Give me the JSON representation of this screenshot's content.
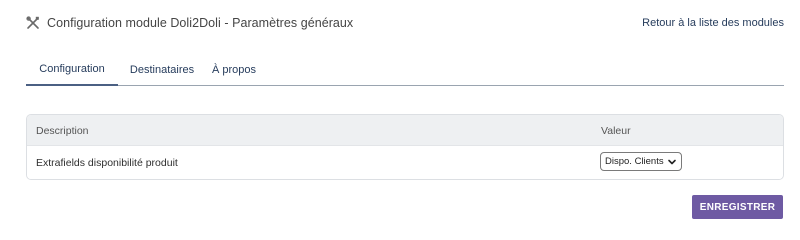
{
  "header": {
    "title": "Configuration module Doli2Doli - Paramètres généraux",
    "title_icon": "tools-icon",
    "back_link": "Retour à la liste des modules"
  },
  "tabs": [
    {
      "label": "Configuration",
      "active": true
    },
    {
      "label": "Destinataires",
      "active": false
    },
    {
      "label": "À propos",
      "active": false
    }
  ],
  "table": {
    "columns": [
      "Description",
      "Valeur"
    ],
    "rows": [
      {
        "description": "Extrafields disponibilité produit",
        "value": "Dispo. Clients"
      }
    ]
  },
  "save_button": {
    "label": "ENREGISTRER"
  },
  "colors": {
    "link": "#263c5c",
    "accent": "#6e5aa3",
    "table_header_bg": "#eef0f2"
  }
}
